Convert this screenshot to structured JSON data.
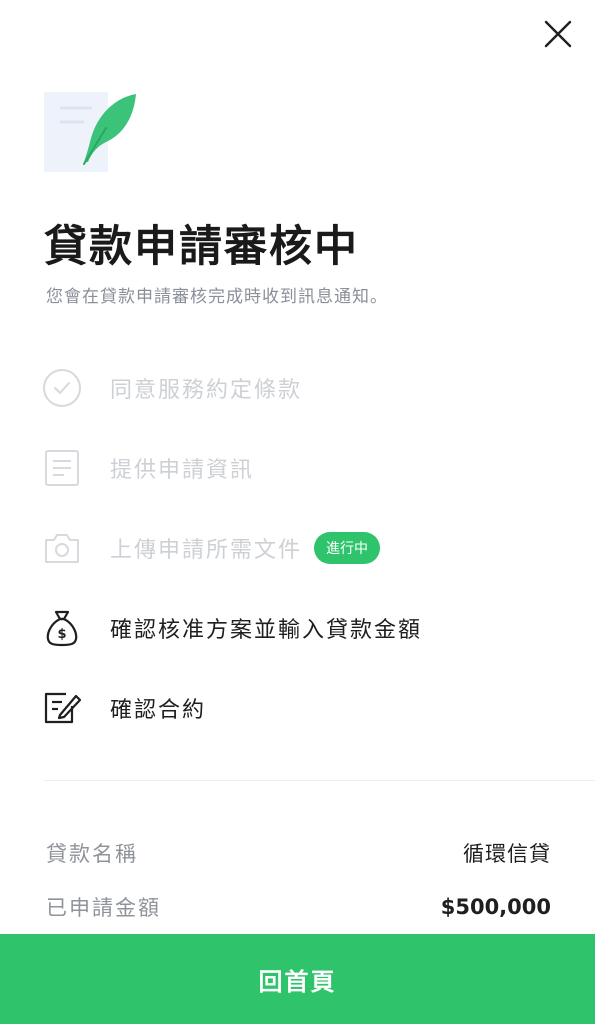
{
  "header": {
    "close_icon": "close-icon"
  },
  "title": "貸款申請審核中",
  "subtitle": "您會在貸款申請審核完成時收到訊息通知。",
  "steps": [
    {
      "label": "同意服務約定條款",
      "icon": "check-circle-icon",
      "status": "done"
    },
    {
      "label": "提供申請資訊",
      "icon": "document-icon",
      "status": "done"
    },
    {
      "label": "上傳申請所需文件",
      "icon": "camera-icon",
      "status": "in-progress",
      "badge": "進行中"
    },
    {
      "label": "確認核准方案並輸入貸款金額",
      "icon": "money-bag-icon",
      "status": "todo"
    },
    {
      "label": "確認合約",
      "icon": "sign-contract-icon",
      "status": "todo"
    }
  ],
  "details": {
    "loan_name_label": "貸款名稱",
    "loan_name_value": "循環信貸",
    "amount_label": "已申請金額",
    "amount_value": "$500,000"
  },
  "footer": {
    "home_button_label": "回首頁"
  },
  "colors": {
    "accent": "#2fc46b",
    "muted_text": "#cdd0d4",
    "secondary_text": "#8f939a"
  }
}
